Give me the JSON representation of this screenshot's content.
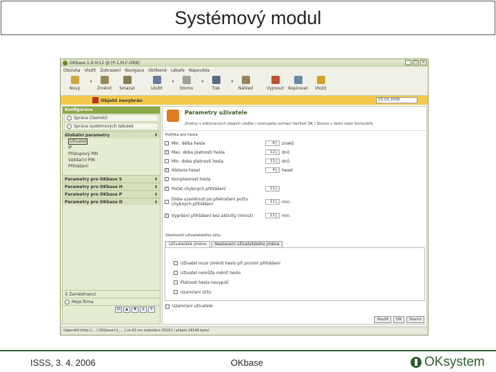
{
  "slide": {
    "title": "Systémový modul",
    "footer_date": "ISSS, 3. 4. 2006",
    "footer_center": "OKbase",
    "logo_text": "OKsystem"
  },
  "window": {
    "title": "OKbase 1.9.0r12 @ [P-1,M,F-OKB]",
    "controls": [
      "_",
      "□",
      "×"
    ]
  },
  "menu": [
    "Obsluha",
    "Vložit",
    "Zobrazení",
    "Navigace",
    "Oblíbené",
    "Lékaře",
    "Nápověda"
  ],
  "toolbar": {
    "buttons": [
      {
        "label": "Nový",
        "color": "#d8a040"
      },
      {
        "label": "Změnit",
        "color": "#9a8a5a"
      },
      {
        "label": "Smazat",
        "color": "#8a7a5a"
      },
      {
        "label": "Uložit",
        "color": "#6a7a9a"
      },
      {
        "label": "Storno",
        "color": "#a0a0a0"
      },
      {
        "label": "Tisk",
        "color": "#5a6a8a"
      },
      {
        "label": "Náhled",
        "color": "#9a8060"
      },
      {
        "label": "Vyjmout",
        "color": "#c05030"
      },
      {
        "label": "Kopírovat",
        "color": "#6a8aaa"
      },
      {
        "label": "Vložit",
        "color": "#d0a030"
      }
    ]
  },
  "object_bar": {
    "label": "Objekt nevybrán",
    "date": "03.03.2006"
  },
  "left": {
    "header": "Konfigurace",
    "top_items": [
      "Správa číselníků",
      "Správa systémových tabulek"
    ],
    "group_global": "Globální parametry",
    "sub_items": [
      "Uživatel",
      "IP",
      "Přístupový PIN",
      "Validační PIN",
      "Přihlášení"
    ],
    "groups": [
      "Parametry pro OKbase S",
      "Parametry pro OKbase H",
      "Parametry pro OKbase P",
      "Parametry pro OKbase D"
    ],
    "foot_items": [
      "Zaměstnanci",
      "Moje firma"
    ],
    "page_number": "16"
  },
  "right": {
    "title": "Parametry uživatele",
    "hint": "Změny v editovaných údajích uložte / stornujete ozmací tlačítek OK / Storno v dolní části formuláře.",
    "section_password": "Politika pro hesla",
    "rows": [
      {
        "label": "Min. délka hesla",
        "checked": false,
        "value": "6",
        "unit": "znaků"
      },
      {
        "label": "Max. doba platnosti hesla",
        "checked": true,
        "value": "12",
        "unit": "dnů"
      },
      {
        "label": "Min. doba platnosti hesla",
        "checked": false,
        "value": "11",
        "unit": "dnů"
      },
      {
        "label": "Historie hesel",
        "checked": true,
        "value": "4",
        "unit": "hesel"
      },
      {
        "label": "Komplexnost hesla",
        "checked": false,
        "value": "",
        "unit": ""
      },
      {
        "label": "Počet chybných přihlášení",
        "checked": true,
        "value": "11",
        "unit": ""
      },
      {
        "label": "Doba uzamknutí po překročení počtu chybných přihlášení",
        "checked": false,
        "value": "11",
        "unit": "min."
      },
      {
        "label": "Vypršení přihlášení bez aktivity (minut)",
        "checked": true,
        "value": "11",
        "unit": "min."
      }
    ],
    "section_accounts": "Vlastnosti uživatelského účtu",
    "tabs": [
      "Uživatelské jméno",
      "Nastavení uživatelského jména"
    ],
    "panel_options": [
      "Uživatel musí změnit heslo při prvním přihlášení",
      "Uživatel nemůže měnit heslo",
      "Platnost hesla nevyprší",
      "Uzamčení účtu"
    ],
    "bottom_check": "Uzamčení uživatele",
    "buttons": [
      "Použít",
      "OK",
      "Storno"
    ]
  },
  "status": "Odpověď (http://... ) OK[base=1_... ] za 63 ms (odesláno 30161 / přijato 29148 byte)"
}
